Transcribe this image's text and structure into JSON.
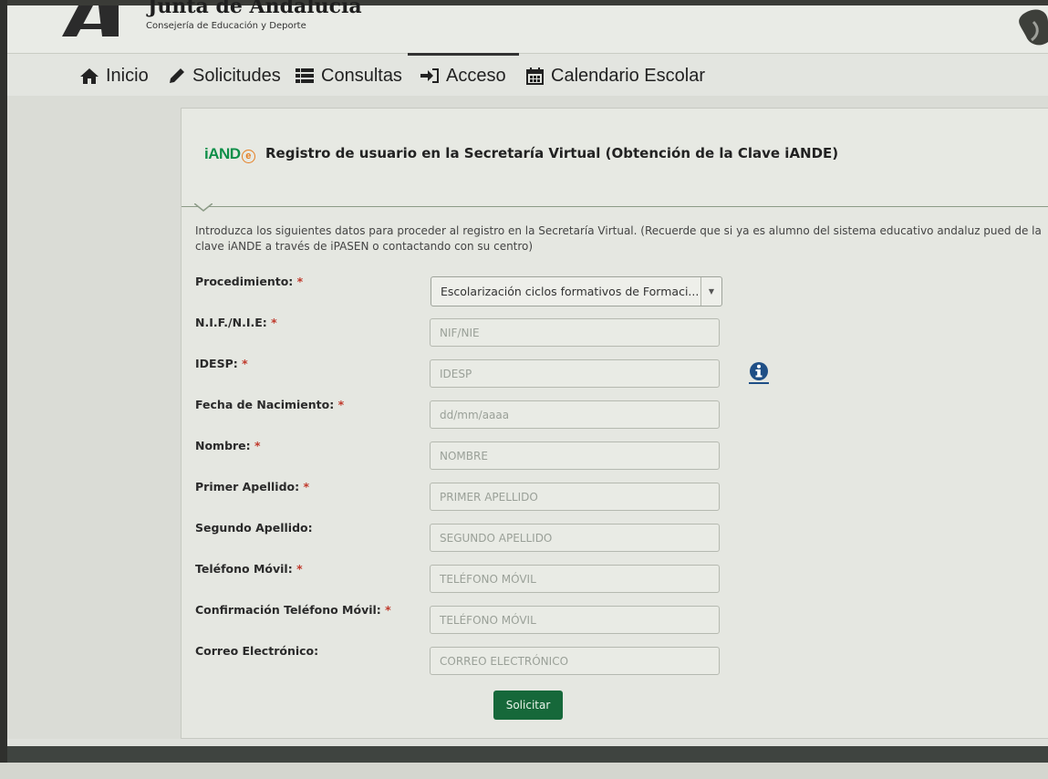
{
  "header": {
    "brand_title": "Junta de Andalucía",
    "brand_subtitle": "Consejería de Educación y Deporte"
  },
  "nav": {
    "items": [
      {
        "label": "Inicio",
        "icon": "home-icon"
      },
      {
        "label": "Solicitudes",
        "icon": "pencil-icon"
      },
      {
        "label": "Consultas",
        "icon": "list-icon"
      },
      {
        "label": "Acceso",
        "icon": "sign-in-icon",
        "active": true
      },
      {
        "label": "Calendario Escolar",
        "icon": "calendar-icon"
      }
    ]
  },
  "panel": {
    "logo_text": "iAND",
    "logo_e": "e",
    "title": "Registro de usuario en la Secretaría Virtual (Obtención de la Clave iANDE)",
    "intro": "Introduzca los siguientes datos para proceder al registro en la Secretaría Virtual. (Recuerde que si ya es alumno del sistema educativo andaluz pued de la clave iANDE a través de iPASEN o contactando con su centro)"
  },
  "form": {
    "required_mark": "*",
    "procedimiento_label": "Procedimiento:",
    "procedimiento_value": "Escolarización ciclos formativos de Formaci...",
    "nif_label": "N.I.F./N.I.E:",
    "nif_placeholder": "NIF/NIE",
    "idesp_label": "IDESP:",
    "idesp_placeholder": "IDESP",
    "fecha_label": "Fecha de Nacimiento:",
    "fecha_placeholder": "dd/mm/aaaa",
    "nombre_label": "Nombre:",
    "nombre_placeholder": "NOMBRE",
    "apellido1_label": "Primer Apellido:",
    "apellido1_placeholder": "PRIMER APELLIDO",
    "apellido2_label": "Segundo Apellido:",
    "apellido2_placeholder": "SEGUNDO APELLIDO",
    "movil_label": "Teléfono Móvil:",
    "movil_placeholder": "TELÉFONO MÓVIL",
    "movil_conf_label": "Confirmación Teléfono Móvil:",
    "movil_conf_placeholder": "TELÉFONO MÓVIL",
    "correo_label": "Correo Electrónico:",
    "correo_placeholder": "CORREO ELECTRÓNICO",
    "submit_label": "Solicitar"
  },
  "colors": {
    "submit_bg": "#16683a",
    "required": "#c0392b",
    "info_icon": "#1f4f86",
    "logo_green": "#0f8f49",
    "logo_orange": "#e67e22"
  }
}
